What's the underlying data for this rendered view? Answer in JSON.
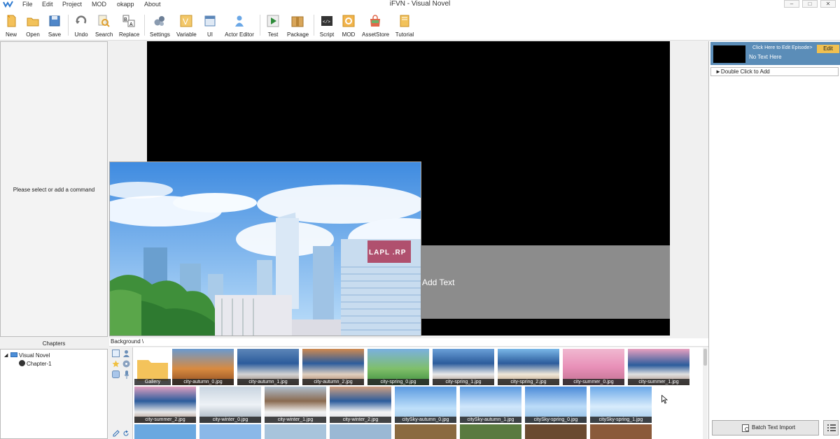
{
  "window": {
    "title": "iFVN - Visual Novel"
  },
  "menu": [
    "File",
    "Edit",
    "Project",
    "MOD",
    "okapp",
    "About"
  ],
  "toolbar": {
    "new": "New",
    "open": "Open",
    "save": "Save",
    "undo": "Undo",
    "search": "Search",
    "replace": "Replace",
    "settings": "Settings",
    "variable": "Variable",
    "ui": "UI",
    "actor_editor": "Actor Editor",
    "test": "Test",
    "package": "Package",
    "script": "Script",
    "mod": "MOD",
    "assetstore": "AssetStore",
    "tutorial": "Tutorial"
  },
  "command_panel": {
    "hint": "Please select or add a command"
  },
  "chapters": {
    "header": "Chapters",
    "root": "Visual Novel",
    "child": "Chapter-1"
  },
  "stage": {
    "textbox_label": "Add Text",
    "sign_text": "LAPL .RP"
  },
  "resources": {
    "path": "Background \\",
    "row1": [
      "Gallery",
      "city-autumn_0.jpg",
      "city-autumn_1.jpg",
      "city-autumn_2.jpg",
      "city-spring_0.jpg",
      "city-spring_1.jpg",
      "city-spring_2.jpg",
      "city-summer_0.jpg",
      "city-summer_1.jpg"
    ],
    "row2": [
      "city-summer_2.jpg",
      "city-winter_0.jpg",
      "city-winter_1.jpg",
      "city-winter_2.jpg",
      "citySky-autumn_0.jpg",
      "citySky-autumn_1.jpg",
      "citySky-spring_0.jpg",
      "citySky-spring_1.jpg"
    ]
  },
  "episode": {
    "edit_link": "Click Here to Edit Episode>",
    "no_text": "No Text Here",
    "edit_button": "Edit",
    "add_row": "►Double Click to Add",
    "batch_import": "Batch Text Import"
  }
}
